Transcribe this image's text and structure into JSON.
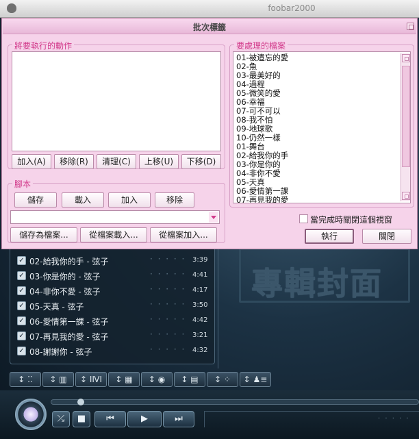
{
  "foobar": {
    "window_title": "foobar2000",
    "cover_placeholder": "專輯封面",
    "playlist": [
      {
        "title": "02-給我你的手 - 弦子",
        "time": "3:39"
      },
      {
        "title": "03-你是你的 - 弦子",
        "time": "4:41"
      },
      {
        "title": "04-非你不愛 - 弦子",
        "time": "4:17"
      },
      {
        "title": "05-天真 - 弦子",
        "time": "3:50"
      },
      {
        "title": "06-愛情第一課 - 弦子",
        "time": "4:42"
      },
      {
        "title": "07-再見我的愛 - 弦子",
        "time": "3:21"
      },
      {
        "title": "08-謝謝你 - 弦子",
        "time": "4:32"
      }
    ],
    "toolbar_glyphs": [
      "↕ ⁚⁚",
      "↕ ▥",
      "↕ ⅠⅣⅠ",
      "↕ ▦",
      "↕ ◉",
      "↕ ▤",
      "↕ ⁘",
      "↕ ♟≡"
    ],
    "transport_glyphs": {
      "shuffle": "⤰",
      "stop": "■",
      "prev": "⏮",
      "play": "▶",
      "next": "⏭"
    },
    "row_dots": "· · · · ·",
    "right_dots": "· · · · ·"
  },
  "dialog": {
    "title": "批次標籤",
    "actions_group": "將要執行的動作",
    "action_buttons": [
      "加入(A)",
      "移除(R)",
      "清理(C)",
      "上移(U)",
      "下移(D)"
    ],
    "script_group": "腳本",
    "script_buttons": [
      "儲存",
      "載入",
      "加入",
      "移除"
    ],
    "script_file_buttons": [
      "儲存為檔案...",
      "從檔案載入...",
      "從檔案加入..."
    ],
    "files_group": "要處理的檔案",
    "files": [
      "01-被遺忘的愛",
      "02-魚",
      "03-最美好的",
      "04-過程",
      "05-微笑的愛",
      "06-幸福",
      "07-可不可以",
      "08-我不怕",
      "09-地球歌",
      "10-仍然一樣",
      "01-舞台",
      "02-給我你的手",
      "03-你是你的",
      "04-非你不愛",
      "05-天真",
      "06-愛情第一課",
      "07-再見我的愛"
    ],
    "close_when_done_label": "當完成時關閉這個視窗",
    "execute_button": "執行",
    "close_button": "關閉"
  }
}
